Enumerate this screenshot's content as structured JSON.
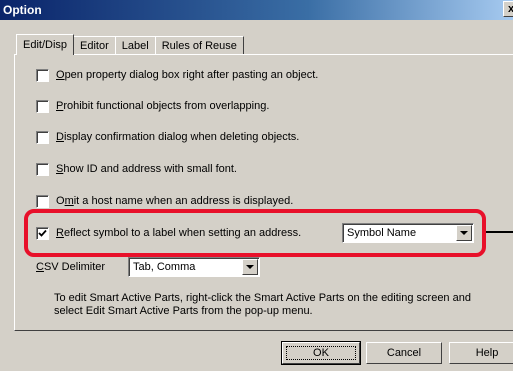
{
  "window": {
    "title": "Option",
    "close_glyph": "x"
  },
  "tabs": [
    {
      "label": "Edit/Disp",
      "active": true
    },
    {
      "label": "Editor",
      "active": false
    },
    {
      "label": "Label",
      "active": false
    },
    {
      "label": "Rules of Reuse",
      "active": false
    }
  ],
  "options": [
    {
      "mnemonic": "O",
      "rest": "pen property dialog box right after pasting an object.",
      "checked": false
    },
    {
      "mnemonic": "P",
      "rest": "rohibit functional objects from overlapping.",
      "checked": false
    },
    {
      "mnemonic": "D",
      "rest": "isplay confirmation dialog when deleting objects.",
      "checked": false
    },
    {
      "mnemonic": "S",
      "rest": "how ID and address with small font.",
      "checked": false
    },
    {
      "pre": "O",
      "mnemonic": "m",
      "rest": "it a host name when an address is displayed.",
      "checked": false
    },
    {
      "mnemonic": "R",
      "rest": "eflect symbol to a label when setting an address.",
      "checked": true
    }
  ],
  "symbol_select": {
    "value": "Symbol Name"
  },
  "csv": {
    "mnemonic": "C",
    "rest": "SV Delimiter",
    "value": "Tab, Comma"
  },
  "info_text": "To edit Smart Active Parts, right-click the Smart Active Parts on the editing screen and select Edit Smart Active Parts from the pop-up menu.",
  "buttons": {
    "ok": "OK",
    "cancel": "Cancel",
    "help": "Help"
  },
  "colors": {
    "highlight": "#e8102a",
    "dialog_face": "#d4d0c8",
    "title_bar": "#0a246a"
  }
}
